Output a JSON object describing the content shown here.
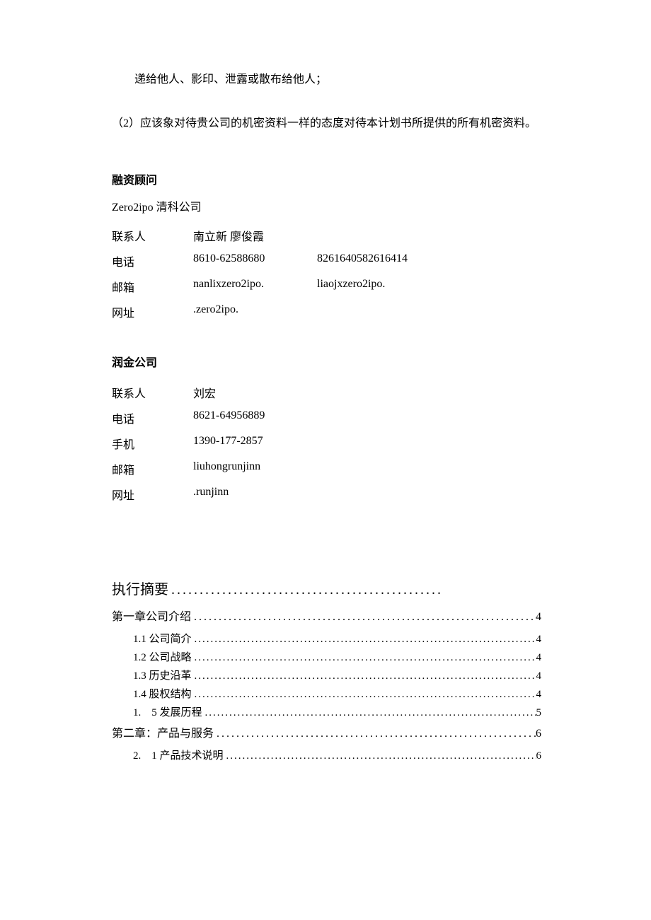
{
  "body": {
    "line1": "递给他人、影印、泄露或散布给他人；",
    "line2": "（2）应该象对待贵公司的机密资料一样的态度对待本计划书所提供的所有机密资料。"
  },
  "advisor": {
    "heading": "融资顾问",
    "company": "Zero2ipo 清科公司",
    "rows": {
      "contact_label": "联系人",
      "contact_val1": "南立新 廖俊霞",
      "phone_label": "电话",
      "phone_val1": "8610-62588680",
      "phone_val2": "8261640582616414",
      "email_label": "邮箱",
      "email_val1": "nanlixzero2ipo.",
      "email_val2": "liaojxzero2ipo.",
      "web_label": "网址",
      "web_val1": ".zero2ipo."
    }
  },
  "company2": {
    "heading": "润金公司",
    "rows": {
      "contact_label": "联系人",
      "contact_val": "刘宏",
      "phone_label": "电话",
      "phone_val": "8621-64956889",
      "mobile_label": "手机",
      "mobile_val": "1390-177-2857",
      "email_label": "邮箱",
      "email_val": "liuhongrunjinn",
      "web_label": "网址",
      "web_val": ".runjinn"
    }
  },
  "toc": {
    "exec_summary": "执行摘要",
    "ch1": {
      "title": "第一章公司介绍",
      "page": "4"
    },
    "ch1_1": {
      "title": "1.1 公司简介",
      "page": "4"
    },
    "ch1_2": {
      "title": "1.2 公司战略",
      "page": "4"
    },
    "ch1_3": {
      "title": "1.3 历史沿革",
      "page": "4"
    },
    "ch1_4": {
      "title": "1.4 股权结构",
      "page": "4"
    },
    "ch1_5": {
      "title": "1.　5 发展历程",
      "page": "5"
    },
    "ch2": {
      "title": "第二章：产品与服务",
      "page": "6"
    },
    "ch2_1": {
      "title": "2.　1 产品技术说明",
      "page": "6"
    }
  },
  "leader_long": "................................................",
  "leader": ".........................................................................................."
}
